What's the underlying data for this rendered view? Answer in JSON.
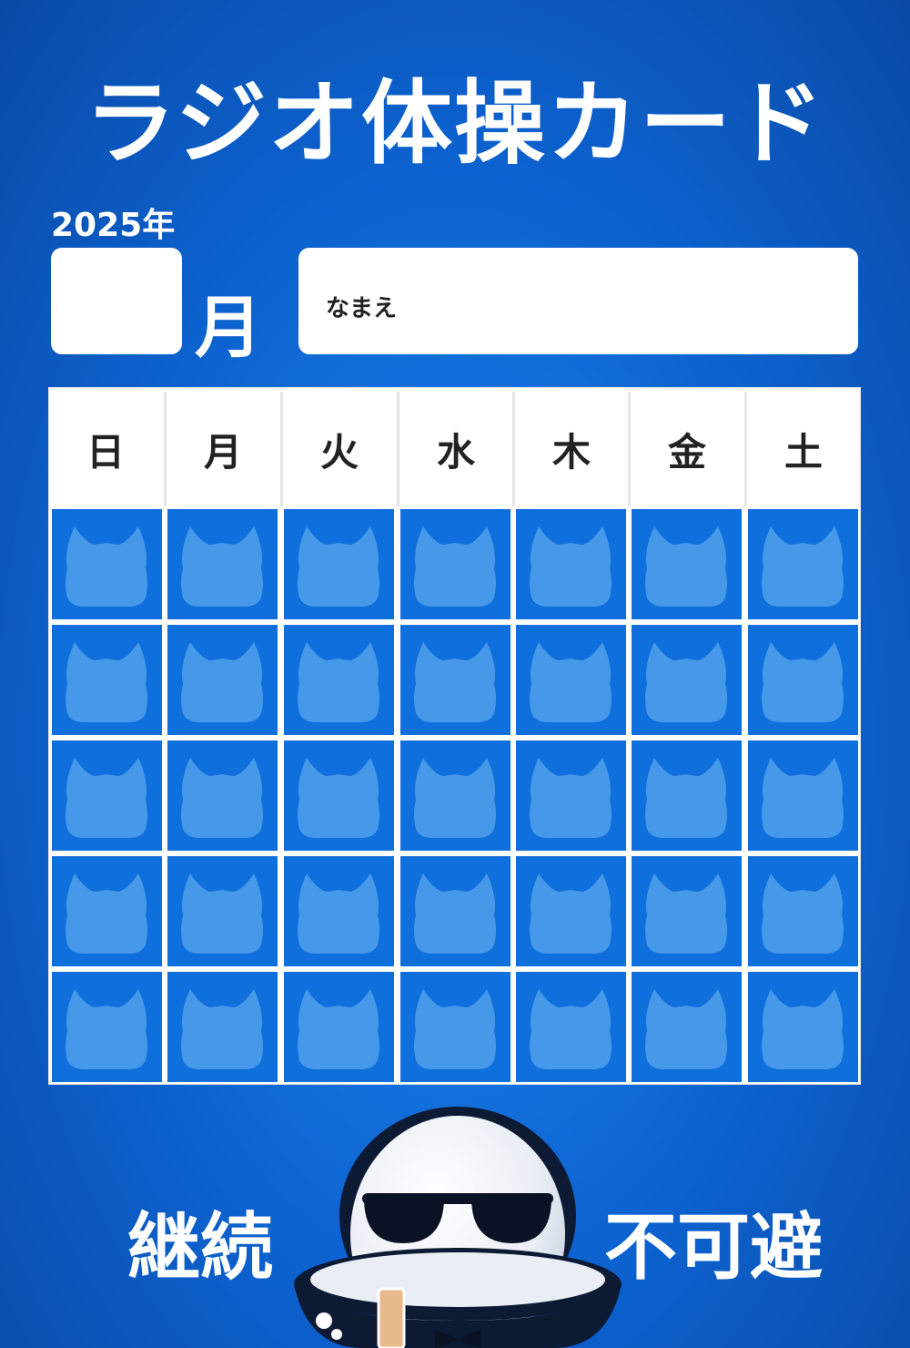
{
  "title": "ラジオ体操カード",
  "year_label": "2025年",
  "month_label": "月",
  "name_label": "なまえ",
  "weekdays": [
    "日",
    "月",
    "火",
    "水",
    "木",
    "金",
    "土"
  ],
  "grid": {
    "rows": 5,
    "columns": 7,
    "stamp_icon": "cat-stamp-icon"
  },
  "motto_left": "継続",
  "motto_right": "不可避",
  "colors": {
    "background": "#0c62cf",
    "cell": "#0f6fdc",
    "stamp": "#5aa6ee",
    "text_dark": "#222222"
  }
}
